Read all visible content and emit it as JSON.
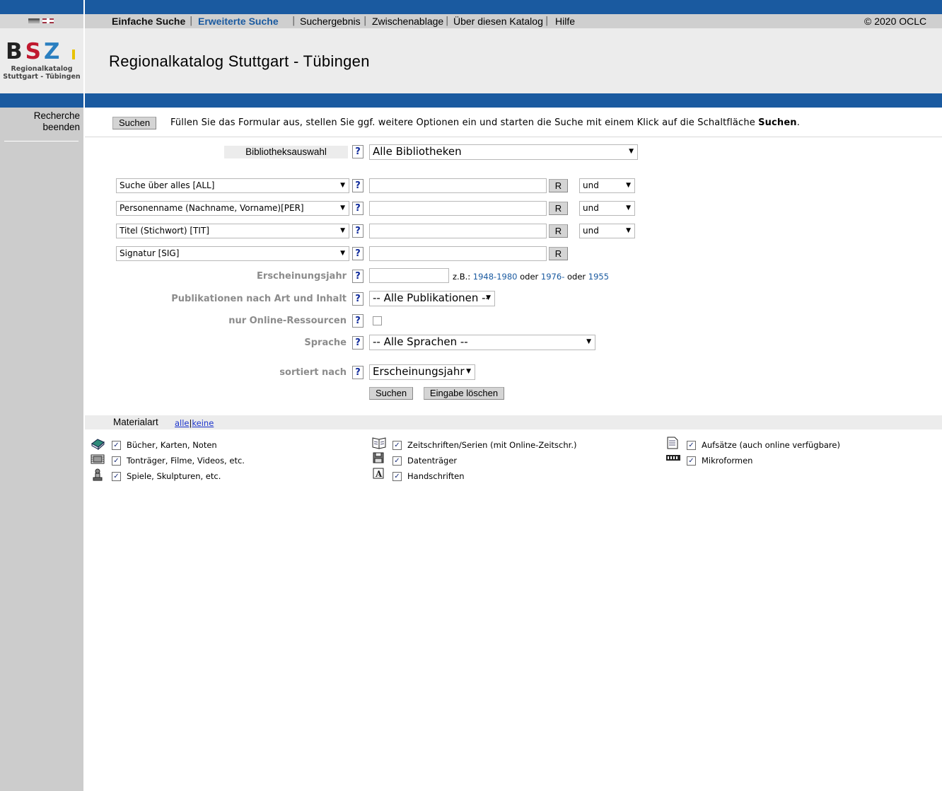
{
  "nav": {
    "items": [
      "Einfache Suche",
      "Erweiterte Suche",
      "Suchergebnis",
      "Zwischenablage",
      "Über diesen Katalog",
      "Hilfe"
    ],
    "copyright": "© 2020 OCLC"
  },
  "logo": {
    "text": "BSZ",
    "line1": "Regionalkatalog",
    "line2": "Stuttgart - Tübingen"
  },
  "header": {
    "title": "Regionalkatalog Stuttgart - Tübingen"
  },
  "sidebar": {
    "end_search_line1": "Recherche",
    "end_search_line2": "beenden"
  },
  "intro": {
    "search_button": "Suchen",
    "text_before": "Füllen Sie das Formular aus, stellen Sie ggf. weitere Optionen ein und starten die Suche mit einem Klick auf die Schaltfläche ",
    "text_bold": "Suchen",
    "text_after": "."
  },
  "library": {
    "label": "Bibliotheksauswahl",
    "help": "?",
    "value": "Alle Bibliotheken"
  },
  "search_rows": [
    {
      "field": "Suche über alles [ALL]",
      "help": "?",
      "r": "R",
      "op": "und"
    },
    {
      "field": "Personenname (Nachname, Vorname)[PER]",
      "help": "?",
      "r": "R",
      "op": "und"
    },
    {
      "field": "Titel (Stichwort) [TIT]",
      "help": "?",
      "r": "R",
      "op": "und"
    },
    {
      "field": "Signatur [SIG]",
      "help": "?",
      "r": "R"
    }
  ],
  "year": {
    "label": "Erscheinungsjahr",
    "help": "?",
    "example_prefix": "z.B.:",
    "ex1": "1948-1980",
    "or1": "oder",
    "ex2": "1976-",
    "or2": "oder",
    "ex3": "1955"
  },
  "publication": {
    "label": "Publikationen nach Art und Inhalt",
    "help": "?",
    "value": "-- Alle Publikationen --"
  },
  "online": {
    "label": "nur Online-Ressourcen",
    "help": "?"
  },
  "language": {
    "label": "Sprache",
    "help": "?",
    "value": "-- Alle Sprachen --"
  },
  "sort": {
    "label": "sortiert nach",
    "help": "?",
    "value": "Erscheinungsjahr"
  },
  "actions": {
    "search": "Suchen",
    "clear": "Eingabe löschen"
  },
  "materials": {
    "title": "Materialart",
    "all": "alle",
    "sep": "|",
    "none": "keine",
    "col1": [
      "Bücher, Karten, Noten",
      "Tonträger, Filme, Videos, etc.",
      "Spiele, Skulpturen, etc."
    ],
    "col2": [
      "Zeitschriften/Serien (mit Online-Zeitschr.)",
      "Datenträger",
      "Handschriften"
    ],
    "col3": [
      "Aufsätze (auch online verfügbare)",
      "Mikroformen"
    ]
  },
  "colors": {
    "brand_blue": "#1a5aa0",
    "sidebar_gray": "#cccccc",
    "active_nav": "#1a5aa0"
  }
}
